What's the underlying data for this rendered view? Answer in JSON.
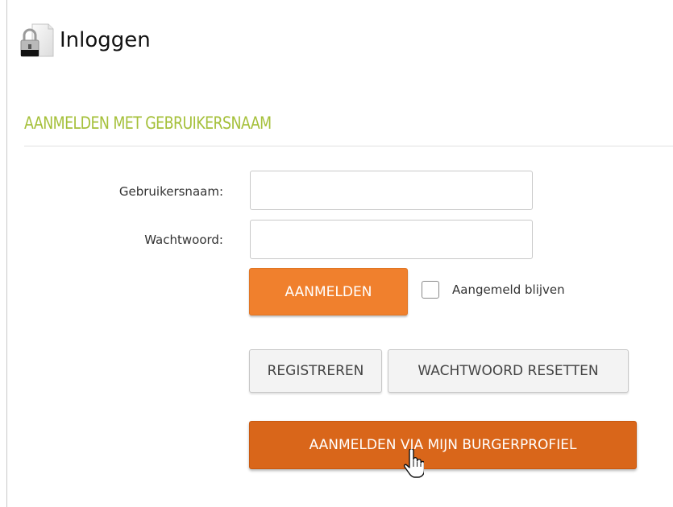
{
  "page": {
    "title": "Inloggen",
    "icon": "lock-document-icon"
  },
  "section": {
    "title": "AANMELDEN MET GEBRUIKERSNAAM"
  },
  "form": {
    "username_label": "Gebruikersnaam:",
    "username_value": "",
    "password_label": "Wachtwoord:",
    "password_value": "",
    "login_button": "AANMELDEN",
    "remember_label": "Aangemeld blijven",
    "remember_checked": false
  },
  "actions": {
    "register_button": "REGISTREREN",
    "reset_button": "WACHTWOORD RESETTEN",
    "profile_button": "AANMELDEN VIA MIJN BURGERPROFIEL"
  },
  "colors": {
    "section_title": "#a5c03a",
    "login_button": "#f0802d",
    "profile_button": "#d9661a"
  },
  "cursor": "hand-pointer-icon"
}
